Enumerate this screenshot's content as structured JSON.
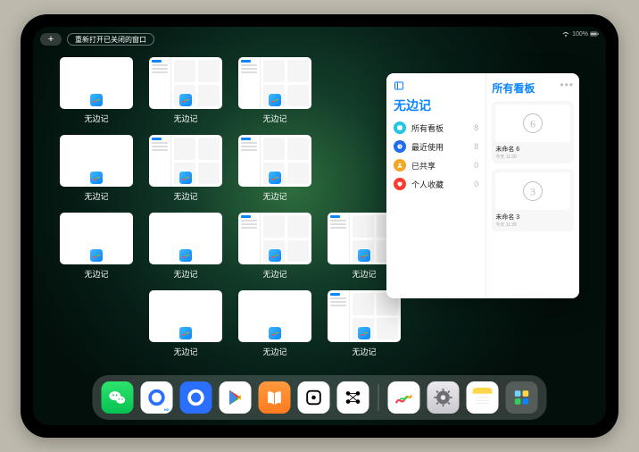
{
  "topbar": {
    "add_label": "+",
    "reload_label": "重新打开已关闭的窗口",
    "battery_text": "100%"
  },
  "app_name": "无边记",
  "windows": [
    {
      "kind": "blank",
      "label": "无边记"
    },
    {
      "kind": "list",
      "label": "无边记"
    },
    {
      "kind": "list",
      "label": "无边记"
    },
    {
      "kind": "blank",
      "label": "无边记"
    },
    {
      "kind": "list",
      "label": "无边记"
    },
    {
      "kind": "list",
      "label": "无边记"
    },
    {
      "kind": "blank",
      "label": "无边记"
    },
    {
      "kind": "blank",
      "label": "无边记"
    },
    {
      "kind": "list",
      "label": "无边记"
    },
    {
      "kind": "list",
      "label": "无边记"
    },
    {
      "kind": "blank",
      "label": "无边记"
    },
    {
      "kind": "blank",
      "label": "无边记"
    },
    {
      "kind": "list",
      "label": "无边记"
    }
  ],
  "grid_layout": [
    [
      0,
      1,
      2,
      null
    ],
    [
      3,
      4,
      5,
      null
    ],
    [
      6,
      7,
      8,
      9
    ],
    [
      null,
      10,
      11,
      12
    ]
  ],
  "popover": {
    "left_title": "无边记",
    "rows": [
      {
        "icon": "all",
        "color": "#25c3e6",
        "label": "所有看板",
        "count": 8
      },
      {
        "icon": "recent",
        "color": "#1f6df1",
        "label": "最近使用",
        "count": 8
      },
      {
        "icon": "shared",
        "color": "#f5a623",
        "label": "已共享",
        "count": 0
      },
      {
        "icon": "fav",
        "color": "#ff3b30",
        "label": "个人收藏",
        "count": 0
      }
    ],
    "right_title": "所有看板",
    "boards": [
      {
        "title": "未命名 6",
        "subtitle": "今天 11:29",
        "glyph": "6"
      },
      {
        "title": "未命名 3",
        "subtitle": "今天 11:28",
        "glyph": "3"
      }
    ]
  },
  "dock": {
    "items": [
      {
        "name": "wechat",
        "semantic": "wechat-icon",
        "bg": "linear-gradient(180deg,#2de36b,#06c152)"
      },
      {
        "name": "quark-hd",
        "semantic": "quark-hd-icon",
        "bg": "#ffffff",
        "hd": "HD"
      },
      {
        "name": "quark",
        "semantic": "quark-icon",
        "bg": "#2b6fff"
      },
      {
        "name": "play",
        "semantic": "play-store-icon",
        "bg": "#ffffff"
      },
      {
        "name": "books",
        "semantic": "books-icon",
        "bg": "linear-gradient(180deg,#ff9a3d,#ff7a1f)"
      },
      {
        "name": "dice",
        "semantic": "dice-icon",
        "bg": "#ffffff"
      },
      {
        "name": "graph",
        "semantic": "graph-icon",
        "bg": "#ffffff"
      },
      {
        "name": "freeform",
        "semantic": "freeform-icon",
        "bg": "#ffffff"
      },
      {
        "name": "settings",
        "semantic": "settings-icon",
        "bg": "linear-gradient(180deg,#e9e9ee,#c8c8ce)"
      },
      {
        "name": "notes",
        "semantic": "notes-icon",
        "bg": "#ffffff"
      },
      {
        "name": "appfolder",
        "semantic": "app-folder-icon",
        "bg": "rgba(255,255,255,.18)"
      }
    ],
    "separator_after_index": 6
  }
}
